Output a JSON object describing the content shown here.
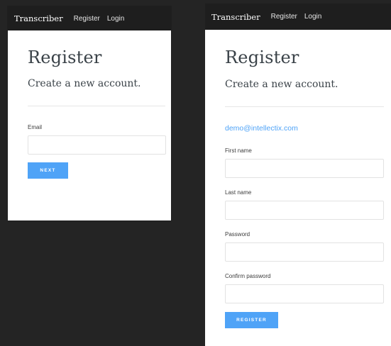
{
  "left": {
    "nav": {
      "brand": "Transcriber",
      "links": [
        "Register",
        "Login"
      ]
    },
    "title": "Register",
    "subtitle": "Create a new account.",
    "email": {
      "label": "Email",
      "value": "",
      "placeholder": ""
    },
    "next_label": "NEXT"
  },
  "right": {
    "nav": {
      "brand": "Transcriber",
      "links": [
        "Register",
        "Login"
      ]
    },
    "title": "Register",
    "subtitle": "Create a new account.",
    "email_display": "demo@intellectix.com",
    "fields": [
      {
        "label": "First name",
        "value": ""
      },
      {
        "label": "Last name",
        "value": ""
      },
      {
        "label": "Password",
        "value": ""
      },
      {
        "label": "Confirm password",
        "value": ""
      }
    ],
    "register_label": "REGISTER"
  },
  "colors": {
    "navbar": "#1e1e1e",
    "accent": "#4fa3f7",
    "background": "#242424",
    "heading_text": "#3a4248"
  }
}
